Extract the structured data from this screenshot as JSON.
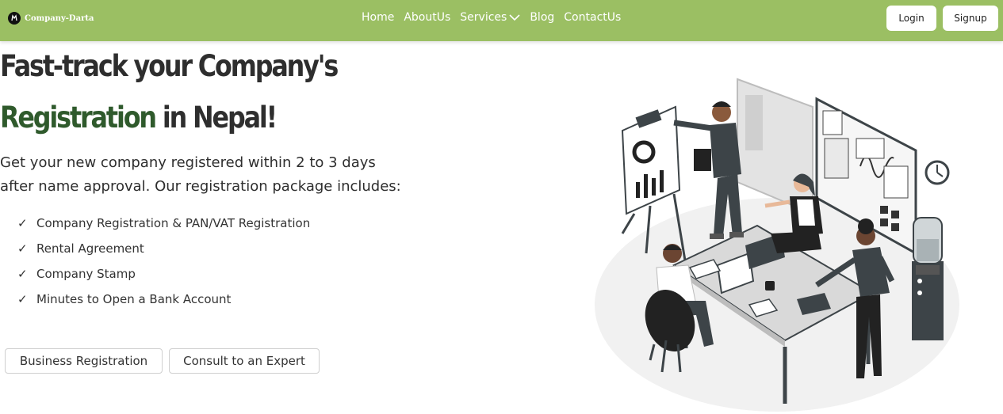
{
  "navbar": {
    "brand": "Company-Darta",
    "links": [
      "Home",
      "AboutUs",
      "Services",
      "Blog",
      "ContactUs"
    ],
    "login": "Login",
    "signup": "Signup",
    "bg_color": "#9bbf63"
  },
  "hero": {
    "title_line1": "Fast-track your Company's",
    "title_accent": "Registration",
    "title_rest": "in Nepal!",
    "description": "Get your new company registered within 2 to 3 days after name approval. Our registration package includes:",
    "features": [
      "Company Registration & PAN/VAT Registration",
      "Rental Agreement",
      "Company Stamp",
      "Minutes to Open a Bank Account"
    ],
    "check_glyph": "✓",
    "cta_primary": "Business Registration",
    "cta_secondary": "Consult to an Expert",
    "accent_color": "#2f5a2c"
  },
  "icons": {
    "brand": "company-logo-icon",
    "services_dropdown": "chevron-down-icon",
    "feature": "check-icon"
  }
}
